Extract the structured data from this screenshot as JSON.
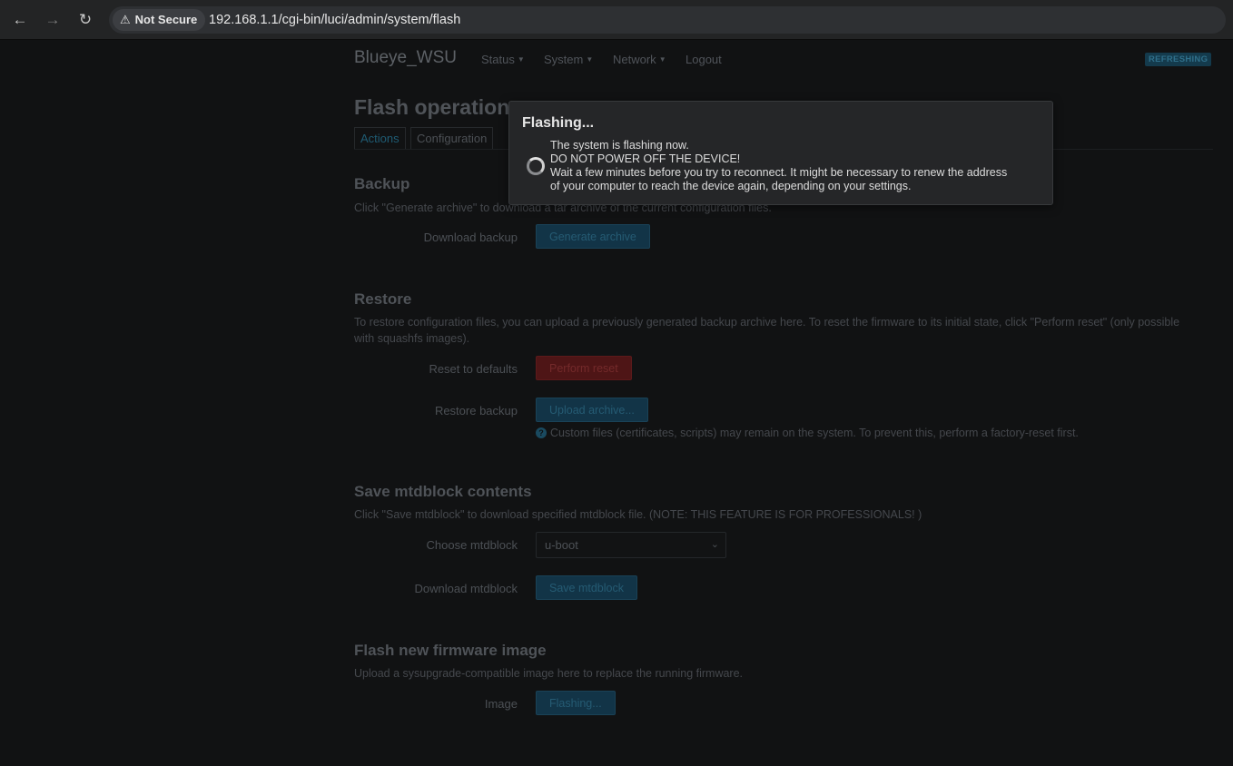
{
  "browser": {
    "security_label": "Not Secure",
    "url": "192.168.1.1/cgi-bin/luci/admin/system/flash"
  },
  "header": {
    "brand": "Blueye_WSU",
    "menu": [
      "Status",
      "System",
      "Network",
      "Logout"
    ],
    "badge": "REFRESHING"
  },
  "page": {
    "title": "Flash operations",
    "tabs": [
      "Actions",
      "Configuration"
    ]
  },
  "backup": {
    "heading": "Backup",
    "description": "Click \"Generate archive\" to download a tar archive of the current configuration files.",
    "download_label": "Download backup",
    "generate_button": "Generate archive"
  },
  "restore": {
    "heading": "Restore",
    "description": "To restore configuration files, you can upload a previously generated backup archive here. To reset the firmware to its initial state, click \"Perform reset\" (only possible with squashfs images).",
    "reset_label": "Reset to defaults",
    "reset_button": "Perform reset",
    "restore_label": "Restore backup",
    "upload_button": "Upload archive...",
    "help": "Custom files (certificates, scripts) may remain on the system. To prevent this, perform a factory-reset first."
  },
  "mtdblock": {
    "heading": "Save mtdblock contents",
    "description": "Click \"Save mtdblock\" to download specified mtdblock file. (NOTE: THIS FEATURE IS FOR PROFESSIONALS! )",
    "choose_label": "Choose mtdblock",
    "selected": "u-boot",
    "download_label": "Download mtdblock",
    "save_button": "Save mtdblock"
  },
  "firmware": {
    "heading": "Flash new firmware image",
    "description": "Upload a sysupgrade-compatible image here to replace the running firmware.",
    "image_label": "Image",
    "flash_button": "Flashing..."
  },
  "modal": {
    "title": "Flashing...",
    "line1": "The system is flashing now.",
    "line2": "DO NOT POWER OFF THE DEVICE!",
    "line3": "Wait a few minutes before you try to reconnect. It might be necessary to renew the address",
    "line4": "of your computer to reach the device again, depending on your settings."
  }
}
